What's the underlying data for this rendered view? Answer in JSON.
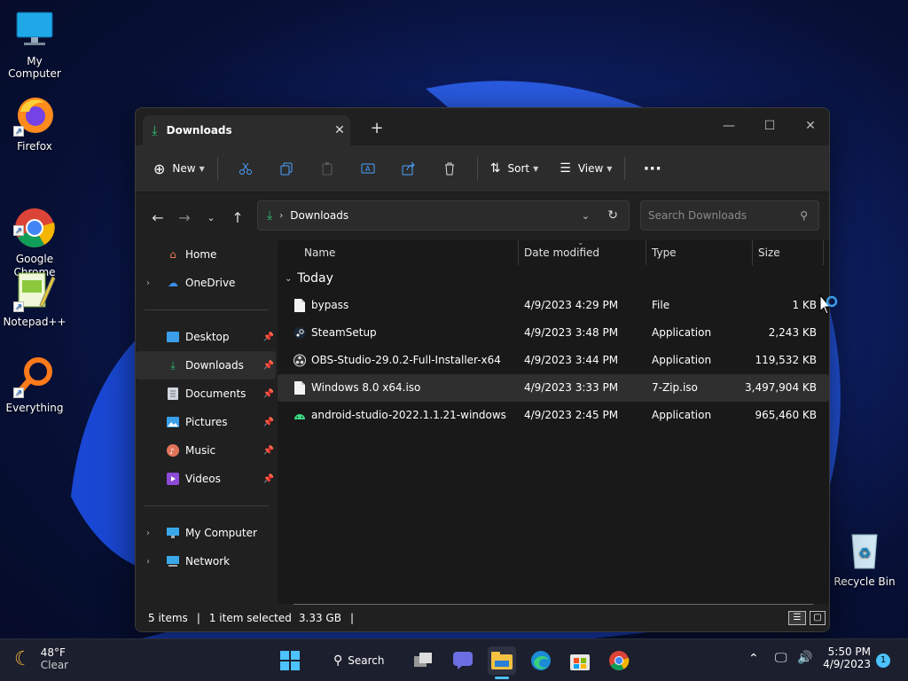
{
  "desktop": {
    "icons": [
      {
        "label": "My Computer"
      },
      {
        "label": "Firefox"
      },
      {
        "label": "Google\nChrome"
      },
      {
        "label": "Notepad++"
      },
      {
        "label": "Everything"
      },
      {
        "label": "Recycle Bin"
      }
    ]
  },
  "window": {
    "tab_title": "Downloads",
    "toolbar": {
      "new_label": "New",
      "sort_label": "Sort",
      "view_label": "View"
    },
    "address": {
      "path": "Downloads",
      "search_placeholder": "Search Downloads"
    },
    "sidebar": {
      "items": [
        {
          "label": "Home"
        },
        {
          "label": "OneDrive"
        },
        {
          "label": "Desktop"
        },
        {
          "label": "Downloads"
        },
        {
          "label": "Documents"
        },
        {
          "label": "Pictures"
        },
        {
          "label": "Music"
        },
        {
          "label": "Videos"
        },
        {
          "label": "My Computer"
        },
        {
          "label": "Network"
        }
      ]
    },
    "columns": {
      "name": "Name",
      "date": "Date modified",
      "type": "Type",
      "size": "Size"
    },
    "group_label": "Today",
    "files": [
      {
        "name": "bypass",
        "date": "4/9/2023 4:29 PM",
        "type": "File",
        "size": "1 KB"
      },
      {
        "name": "SteamSetup",
        "date": "4/9/2023 3:48 PM",
        "type": "Application",
        "size": "2,243 KB"
      },
      {
        "name": "OBS-Studio-29.0.2-Full-Installer-x64",
        "date": "4/9/2023 3:44 PM",
        "type": "Application",
        "size": "119,532 KB"
      },
      {
        "name": "Windows 8.0 x64.iso",
        "date": "4/9/2023 3:33 PM",
        "type": "7-Zip.iso",
        "size": "3,497,904 KB"
      },
      {
        "name": "android-studio-2022.1.1.21-windows",
        "date": "4/9/2023 2:45 PM",
        "type": "Application",
        "size": "965,460 KB"
      }
    ],
    "status": {
      "items": "5 items",
      "selected": "1 item selected",
      "selected_size": "3.33 GB"
    }
  },
  "taskbar": {
    "weather_temp": "48°F",
    "weather_desc": "Clear",
    "search_label": "Search",
    "time": "5:50 PM",
    "date": "4/9/2023",
    "notification_count": "1"
  }
}
